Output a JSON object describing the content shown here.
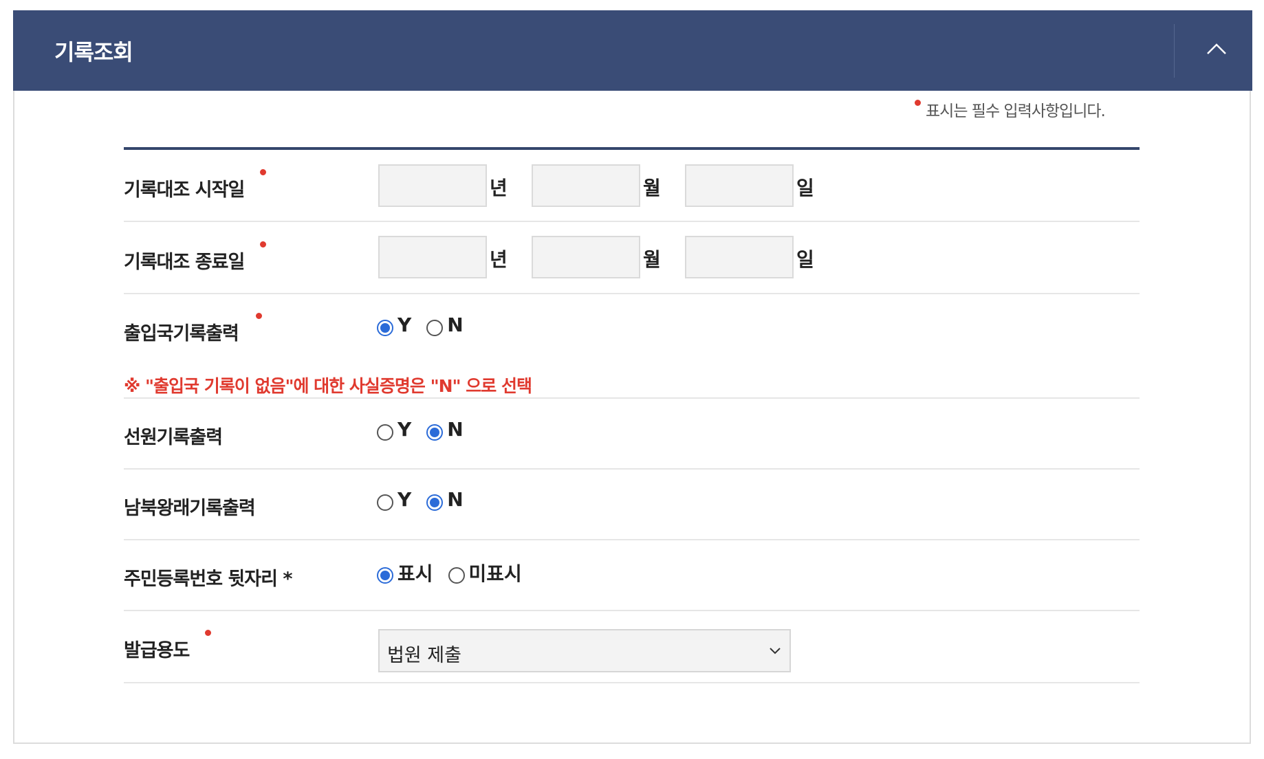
{
  "header": {
    "title": "기록조회"
  },
  "required_note": "표시는 필수 입력사항입니다.",
  "rows": {
    "start_date": {
      "label": "기록대조 시작일",
      "year_unit": "년",
      "month_unit": "월",
      "day_unit": "일"
    },
    "end_date": {
      "label": "기록대조 종료일",
      "year_unit": "년",
      "month_unit": "월",
      "day_unit": "일"
    },
    "immigration": {
      "label": "출입국기록출력",
      "options": [
        "Y",
        "N"
      ],
      "selected": "Y"
    },
    "notice": "※ \"출입국 기록이 없음\"에 대한 사실증명은 \"N\" 으로 선택",
    "crew": {
      "label": "선원기록출력",
      "options": [
        "Y",
        "N"
      ],
      "selected": "N"
    },
    "inter_korea": {
      "label": "남북왕래기록출력",
      "options": [
        "Y",
        "N"
      ],
      "selected": "N"
    },
    "resident_number": {
      "label": "주민등록번호 뒷자리 *",
      "options": [
        "표시",
        "미표시"
      ],
      "selected": "표시"
    },
    "purpose": {
      "label": "발급용도",
      "selected_value": "법원 제출"
    }
  },
  "colors": {
    "header_bg": "#3a4c76",
    "required_dot": "#e03a2f",
    "radio_checked": "#2b6bd8"
  },
  "icons": {
    "collapse": "chevron-up-icon",
    "select_arrow": "chevron-down-icon"
  }
}
